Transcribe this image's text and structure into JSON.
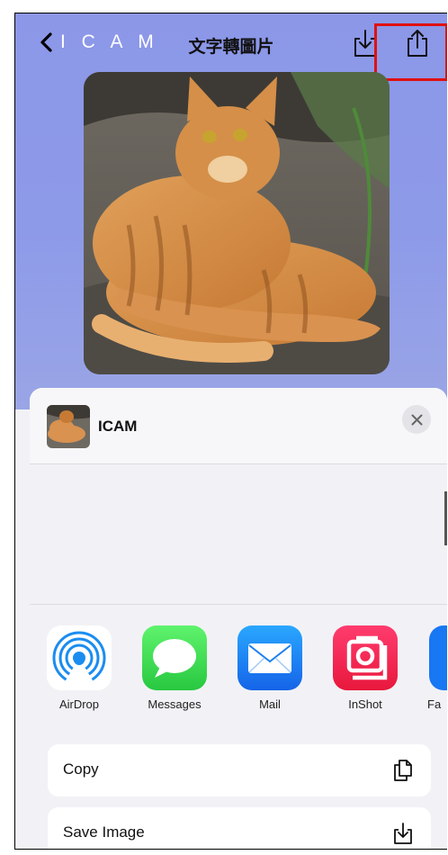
{
  "header": {
    "back_label": "I C A M",
    "title": "文字轉圖片"
  },
  "share_sheet": {
    "app_name": "ICAM",
    "apps": [
      {
        "label": "AirDrop",
        "icon": "airdrop-icon"
      },
      {
        "label": "Messages",
        "icon": "messages-icon"
      },
      {
        "label": "Mail",
        "icon": "mail-icon"
      },
      {
        "label": "InShot",
        "icon": "inshot-icon"
      },
      {
        "label": "Fa",
        "icon": "facebook-icon"
      }
    ],
    "actions": [
      {
        "label": "Copy",
        "icon": "copy-icon"
      },
      {
        "label": "Save Image",
        "icon": "save-image-icon"
      }
    ]
  },
  "colors": {
    "header_gradient": "#8c97e8",
    "highlight": "#e01010",
    "sheet_bg": "#f2f2f6"
  }
}
